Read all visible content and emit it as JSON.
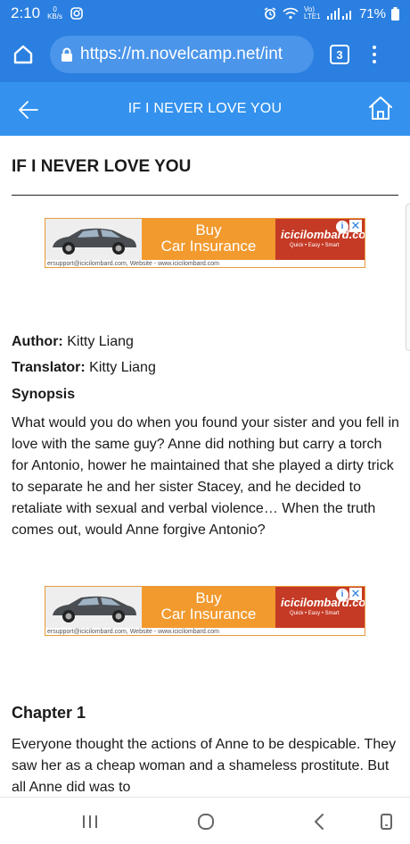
{
  "status": {
    "time": "2:10",
    "speed_value": "0",
    "speed_unit": "KB/s",
    "network": "Vo) LTE1",
    "battery": "71%"
  },
  "browser": {
    "url": "https://m.novelcamp.net/int",
    "tab_count": "3"
  },
  "header": {
    "title": "IF I NEVER LOVE YOU"
  },
  "page": {
    "title": "IF I NEVER LOVE YOU",
    "author_label": "Author:",
    "author": "Kitty Liang",
    "translator_label": "Translator:",
    "translator": "Kitty Liang",
    "synopsis_heading": "Synopsis",
    "synopsis": "What would you do when you found your sister and you fell in love with the same guy? Anne did nothing but carry a torch for Antonio, hower he maintained that she played a dirty trick to separate he and her sister Stacey, and he decided to retaliate with sexual and verbal violence… When the truth comes out, would Anne forgive Antonio?",
    "chapter_title": "Chapter 1",
    "chapter_text": "Everyone thought the actions of Anne to be despicable. They saw her as a cheap woman and a shameless prostitute. But all Anne did was to"
  },
  "ads": [
    {
      "line1": "Buy",
      "line2": "Car Insurance",
      "brand": "icicilombard.com",
      "tagline": "Quick • Easy • Smart",
      "footer": "ersupport@icicilombard.com, Website - www.icicilombard.com"
    },
    {
      "line1": "Buy",
      "line2": "Car Insurance",
      "brand": "icicilombard.com",
      "tagline": "Quick • Easy • Smart",
      "footer": "ersupport@icicilombard.com, Website - www.icicilombard.com"
    }
  ],
  "colors": {
    "browser_bar": "#2a7fe0",
    "site_header": "#3492ee",
    "ad_orange": "#f29a2e",
    "ad_red": "#c53a25"
  },
  "icons": [
    "home-icon",
    "lock-icon",
    "menu-icon",
    "back-arrow-icon",
    "site-home-icon",
    "recent-apps-icon",
    "home-circle-icon",
    "back-chevron-icon",
    "rotate-icon"
  ]
}
